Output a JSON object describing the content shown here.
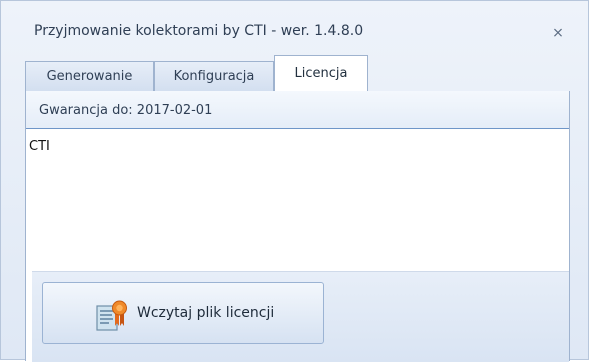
{
  "window": {
    "title": "Przyjmowanie kolektorami by CTI -  wer. 1.4.8.0",
    "close_icon": "close-icon"
  },
  "tabs": [
    {
      "label": "Generowanie",
      "active": false
    },
    {
      "label": "Konfiguracja",
      "active": false
    },
    {
      "label": "Licencja",
      "active": true
    }
  ],
  "license": {
    "warranty_text": "Gwarancja do: 2017-02-01",
    "content_text": "CTI",
    "load_button_label": "Wczytaj plik licencji",
    "load_button_icon": "certificate-icon"
  },
  "colors": {
    "tab_border": "#9fb3cf",
    "accent_line": "#6f96c8",
    "window_bg": "#dfe8f5"
  }
}
